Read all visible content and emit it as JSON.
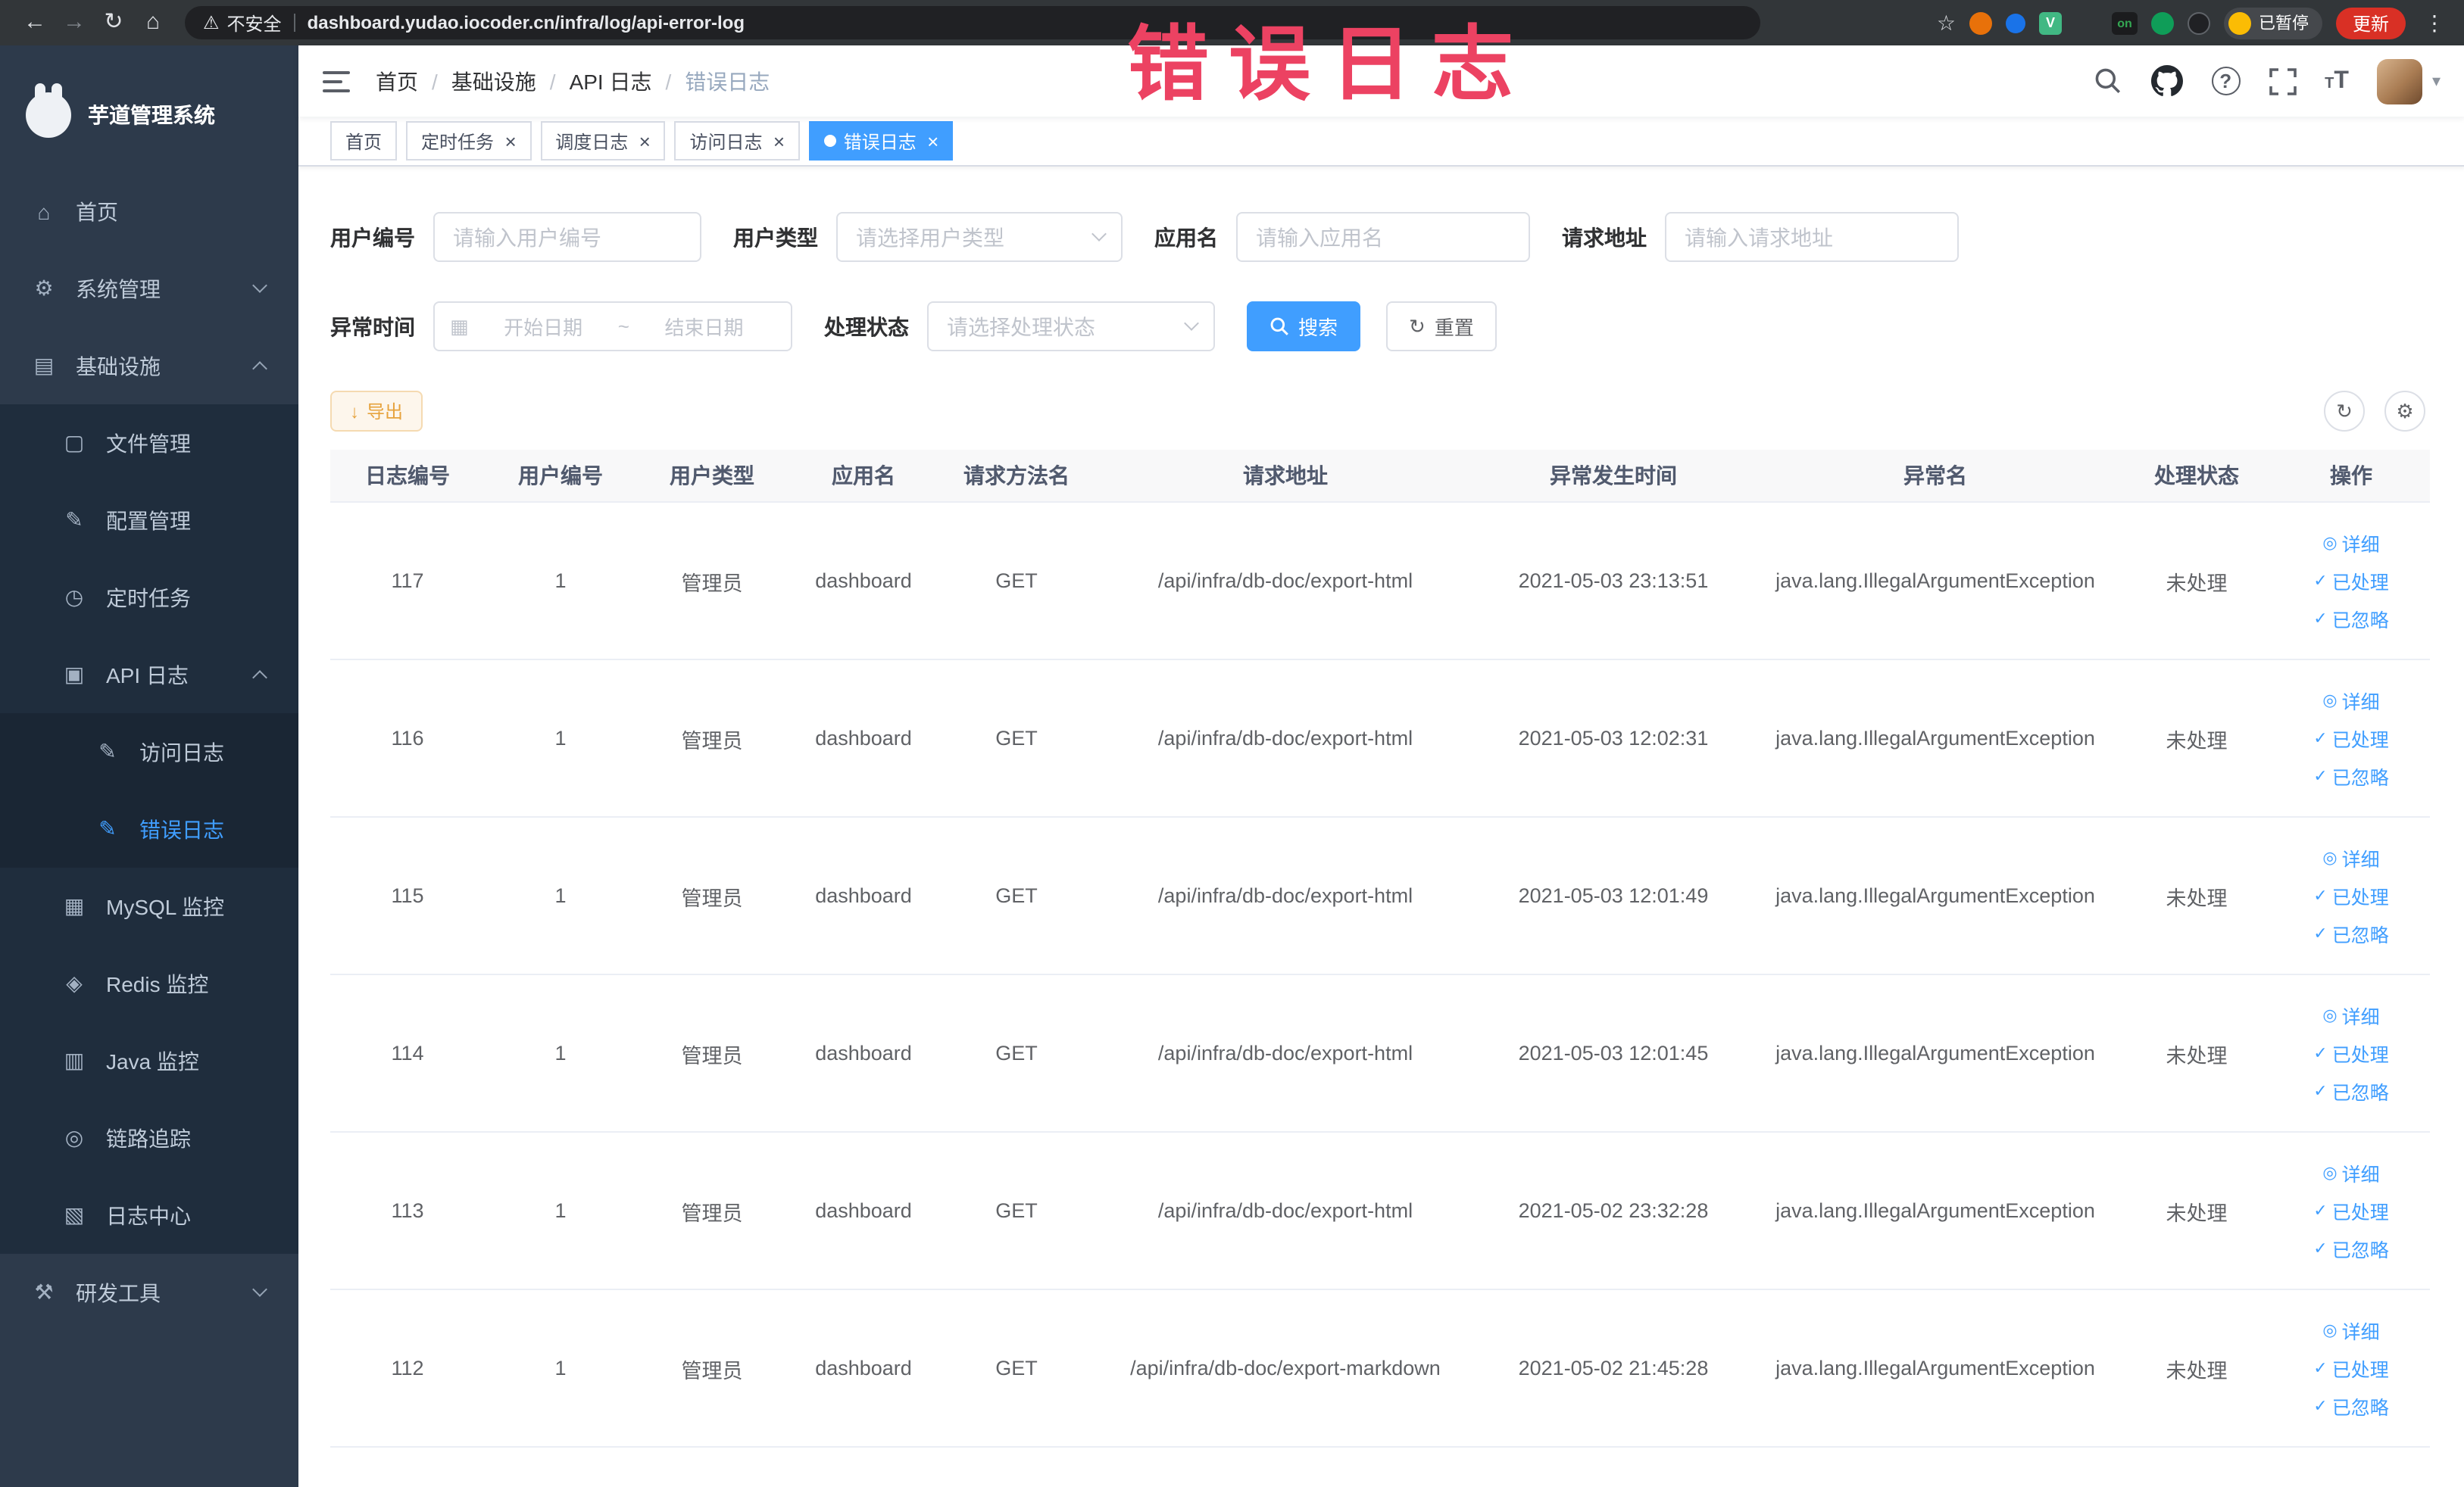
{
  "browser": {
    "security_label": "不安全",
    "url_host": "dashboard.yudao.iocoder.cn",
    "url_path": "/infra/log/api-error-log",
    "vue_ext_letter": "V",
    "on_ext_text": "on",
    "paused_badge": "已暂停",
    "update_button": "更新"
  },
  "annotation": {
    "text": "错误日志",
    "color": "#ec4262"
  },
  "sidebar": {
    "logo_title": "芋道管理系统",
    "items": [
      {
        "name": "home",
        "label": "首页",
        "icon": "home-icon",
        "level": 1
      },
      {
        "name": "system",
        "label": "系统管理",
        "icon": "gear-icon",
        "level": 1,
        "arrow": "down"
      },
      {
        "name": "infra",
        "label": "基础设施",
        "icon": "infra-icon",
        "level": 1,
        "arrow": "up"
      },
      {
        "name": "file-manage",
        "label": "文件管理",
        "icon": "file-icon",
        "level": 2
      },
      {
        "name": "config-manage",
        "label": "配置管理",
        "icon": "edit-icon",
        "level": 2
      },
      {
        "name": "scheduled-jobs",
        "label": "定时任务",
        "icon": "timer-icon",
        "level": 2
      },
      {
        "name": "api-log",
        "label": "API 日志",
        "icon": "api-log-icon",
        "level": 2,
        "arrow": "up"
      },
      {
        "name": "access-log",
        "label": "访问日志",
        "icon": "edit-square-icon",
        "level": 3
      },
      {
        "name": "error-log",
        "label": "错误日志",
        "icon": "edit-square-icon",
        "level": 3,
        "active": true
      },
      {
        "name": "mysql-monitor",
        "label": "MySQL 监控",
        "icon": "mysql-icon",
        "level": 2
      },
      {
        "name": "redis-monitor",
        "label": "Redis 监控",
        "icon": "redis-icon",
        "level": 2
      },
      {
        "name": "java-monitor",
        "label": "Java 监控",
        "icon": "java-icon",
        "level": 2
      },
      {
        "name": "trace",
        "label": "链路追踪",
        "icon": "trace-icon",
        "level": 2
      },
      {
        "name": "log-center",
        "label": "日志中心",
        "icon": "log-center-icon",
        "level": 2
      },
      {
        "name": "dev-tools",
        "label": "研发工具",
        "icon": "tools-icon",
        "level": 1,
        "arrow": "down"
      }
    ]
  },
  "header": {
    "breadcrumb": [
      "首页",
      "基础设施",
      "API 日志",
      "错误日志"
    ]
  },
  "tabs": [
    {
      "label": "首页",
      "closable": false,
      "active": false
    },
    {
      "label": "定时任务",
      "closable": true,
      "active": false
    },
    {
      "label": "调度日志",
      "closable": true,
      "active": false
    },
    {
      "label": "访问日志",
      "closable": true,
      "active": false
    },
    {
      "label": "错误日志",
      "closable": true,
      "active": true
    }
  ],
  "filters": {
    "user_id": {
      "label": "用户编号",
      "placeholder": "请输入用户编号",
      "value": ""
    },
    "user_type": {
      "label": "用户类型",
      "placeholder": "请选择用户类型"
    },
    "app_name": {
      "label": "应用名",
      "placeholder": "请输入应用名",
      "value": ""
    },
    "request_url": {
      "label": "请求地址",
      "placeholder": "请输入请求地址",
      "value": ""
    },
    "exception_time": {
      "label": "异常时间",
      "start_placeholder": "开始日期",
      "separator": "~",
      "end_placeholder": "结束日期"
    },
    "process_status": {
      "label": "处理状态",
      "placeholder": "请选择处理状态"
    },
    "search_button": "搜索",
    "reset_button": "重置"
  },
  "toolbar": {
    "export_button": "导出"
  },
  "table": {
    "columns": [
      "日志编号",
      "用户编号",
      "用户类型",
      "应用名",
      "请求方法名",
      "请求地址",
      "异常发生时间",
      "异常名",
      "处理状态",
      "操作"
    ],
    "action_labels": {
      "detail": "详细",
      "processed": "已处理",
      "ignored": "已忽略"
    },
    "rows": [
      {
        "id": "117",
        "user_id": "1",
        "user_type": "管理员",
        "app": "dashboard",
        "method": "GET",
        "url": "/api/infra/db-doc/export-html",
        "time": "2021-05-03 23:13:51",
        "exception": "java.lang.IllegalArgumentException",
        "status": "未处理"
      },
      {
        "id": "116",
        "user_id": "1",
        "user_type": "管理员",
        "app": "dashboard",
        "method": "GET",
        "url": "/api/infra/db-doc/export-html",
        "time": "2021-05-03 12:02:31",
        "exception": "java.lang.IllegalArgumentException",
        "status": "未处理"
      },
      {
        "id": "115",
        "user_id": "1",
        "user_type": "管理员",
        "app": "dashboard",
        "method": "GET",
        "url": "/api/infra/db-doc/export-html",
        "time": "2021-05-03 12:01:49",
        "exception": "java.lang.IllegalArgumentException",
        "status": "未处理"
      },
      {
        "id": "114",
        "user_id": "1",
        "user_type": "管理员",
        "app": "dashboard",
        "method": "GET",
        "url": "/api/infra/db-doc/export-html",
        "time": "2021-05-03 12:01:45",
        "exception": "java.lang.IllegalArgumentException",
        "status": "未处理"
      },
      {
        "id": "113",
        "user_id": "1",
        "user_type": "管理员",
        "app": "dashboard",
        "method": "GET",
        "url": "/api/infra/db-doc/export-html",
        "time": "2021-05-02 23:32:28",
        "exception": "java.lang.IllegalArgumentException",
        "status": "未处理"
      },
      {
        "id": "112",
        "user_id": "1",
        "user_type": "管理员",
        "app": "dashboard",
        "method": "GET",
        "url": "/api/infra/db-doc/export-markdown",
        "time": "2021-05-02 21:45:28",
        "exception": "java.lang.IllegalArgumentException",
        "status": "未处理"
      }
    ]
  }
}
